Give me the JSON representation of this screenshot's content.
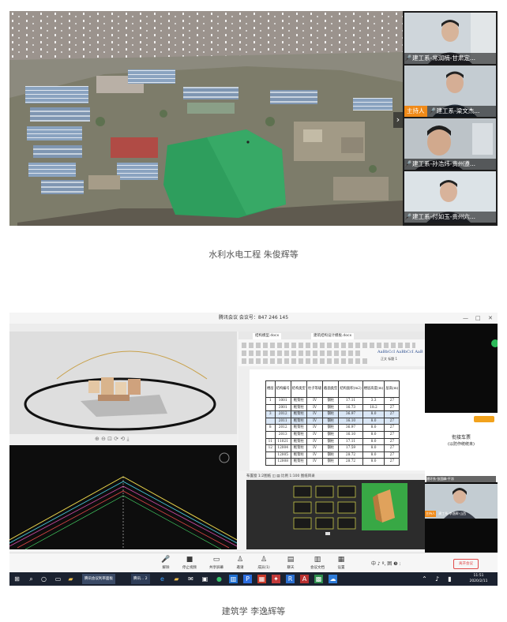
{
  "figure1": {
    "participants": [
      {
        "name": "建工系-常润楠-甘肃定...",
        "host": false
      },
      {
        "name": "建工系-梁文杰...",
        "host": true,
        "host_label": "主持人"
      },
      {
        "name": "建工系-孙浩炜-贵州遵...",
        "host": false
      },
      {
        "name": "建工系-付如玉-贵州六...",
        "host": false
      }
    ],
    "collapse_glyph": "›",
    "caption": "水利水电工程 朱俊辉等"
  },
  "figure2": {
    "window_title": "腾讯会议 会议号：847 246 145",
    "window_controls": [
      "—",
      "□",
      "✕"
    ],
    "render_tools": "⊕ ⊖ ⊡  ⟳ ⟲  ⤓",
    "doc": {
      "tabs": [
        "结构模型.docx",
        "建筑结构设计模板.docx"
      ],
      "style_boxes": [
        "AaBbCcI AaBbCcI AaB",
        "正文  标题 1"
      ],
      "table": {
        "headers": [
          "楼层",
          "结构编号",
          "结构类型",
          "柱子等级",
          "截面类型",
          "结构面积(m2)",
          "楼层高度(m)",
          "层高(m)"
        ],
        "rows": [
          [
            "1",
            "1001",
            "框架柱",
            "IV",
            "钢柱",
            "17.11",
            "3.3",
            "27"
          ],
          [
            "",
            "2001",
            "框架柱",
            "IV",
            "钢柱",
            "16.73",
            "18.2",
            "27"
          ],
          [
            "3",
            "2012",
            "框架柱",
            "IV",
            "钢柱",
            "36.97",
            "8.0",
            "27"
          ],
          [
            "",
            "2011",
            "框架柱",
            "IV",
            "钢柱",
            "16.10",
            "8.0",
            "27"
          ],
          [
            "8",
            "2012",
            "框架柱",
            "IV",
            "钢柱",
            "36.97",
            "8.0",
            "27"
          ],
          [
            "",
            "2013",
            "框架柱",
            "IV",
            "钢柱",
            "16.10",
            "8.0",
            "27"
          ],
          [
            "11",
            "11021",
            "框架柱",
            "IV",
            "钢柱",
            "17.11",
            "8.0",
            "27"
          ],
          [
            "12",
            "12004",
            "框架柱",
            "IV",
            "钢柱",
            "17.59",
            "8.0",
            "27"
          ],
          [
            "",
            "12005",
            "框架柱",
            "IV",
            "钢柱",
            "28.72",
            "8.0",
            "27"
          ],
          [
            "",
            "12008",
            "框架柱",
            "IV",
            "钢柱",
            "28.72",
            "8.0",
            "27"
          ]
        ]
      }
    },
    "model_toolbar": "布置窗 1:2图纸  ◫  ▤  比例 1:100  图纸目录",
    "card": {
      "title": "衔接车票",
      "subtitle": "(以防作统统未)",
      "name": "建环系-张国峰-平凉"
    },
    "cam_name": "建工系-李逸辉-山西",
    "host_label": "主持人",
    "meeting_toolbar": [
      {
        "icon": "🎤",
        "label": "解除"
      },
      {
        "icon": "■",
        "label": "停止视频"
      },
      {
        "icon": "▭",
        "label": "共享屏幕"
      },
      {
        "icon": "♙",
        "label": "邀请"
      },
      {
        "icon": "♙",
        "label": "成员(1)"
      },
      {
        "icon": "▤",
        "label": "聊天"
      },
      {
        "icon": "▥",
        "label": "会议文档"
      },
      {
        "icon": "▦",
        "label": "设置"
      }
    ],
    "ime": "中 ♪ º, 囲 ❸ :",
    "end_button": "离开会议",
    "taskbar": {
      "active_task": "腾讯会议利率面板",
      "active_task2": "腾讯... 2",
      "time": "11:51",
      "date": "2020/2/11"
    },
    "caption": "建筑学   李逸辉等"
  }
}
